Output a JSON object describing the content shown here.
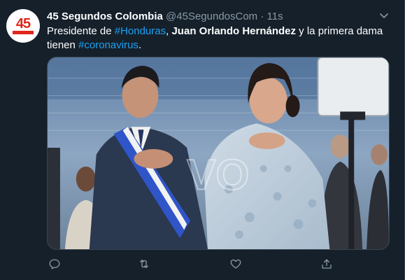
{
  "tweet": {
    "author": {
      "name": "45 Segundos Colombia",
      "handle": "@45SegundosCom",
      "avatar_text": "45",
      "avatar_icon": "45-segundos-logo"
    },
    "separator": "·",
    "time": "11s",
    "text": {
      "part1": "Presidente de ",
      "hashtag1": "#Honduras",
      "part2": ", ",
      "bold_name": "Juan Orlando Hernández",
      "part3": " y la primera dama tienen ",
      "hashtag2": "#coronavirus",
      "part4": "."
    },
    "media": {
      "watermark": "VO"
    },
    "actions": [
      {
        "name": "reply",
        "icon": "speech-bubble-icon"
      },
      {
        "name": "retweet",
        "icon": "retweet-icon"
      },
      {
        "name": "like",
        "icon": "heart-icon"
      },
      {
        "name": "share",
        "icon": "share-icon"
      }
    ]
  },
  "colors": {
    "background": "#15202b",
    "primary_text": "#ffffff",
    "secondary_text": "#8899a6",
    "accent": "#1da1f2",
    "border": "#38444d"
  }
}
